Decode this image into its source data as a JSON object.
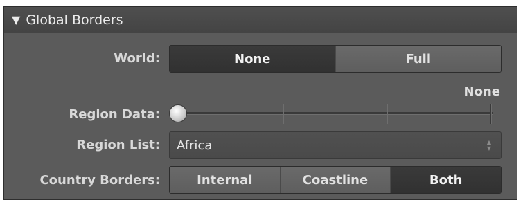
{
  "panel": {
    "title": "Global Borders",
    "collapse_icon": "triangle-down-icon"
  },
  "world": {
    "label": "World:",
    "options": [
      "None",
      "Full"
    ],
    "selected": "None"
  },
  "region_data": {
    "label": "Region Data:",
    "value_text": "None",
    "value": 0
  },
  "region_list": {
    "label": "Region List:",
    "value": "Africa"
  },
  "country_borders": {
    "label": "Country Borders:",
    "options": [
      "Internal",
      "Coastline",
      "Both"
    ],
    "selected": "Both"
  }
}
